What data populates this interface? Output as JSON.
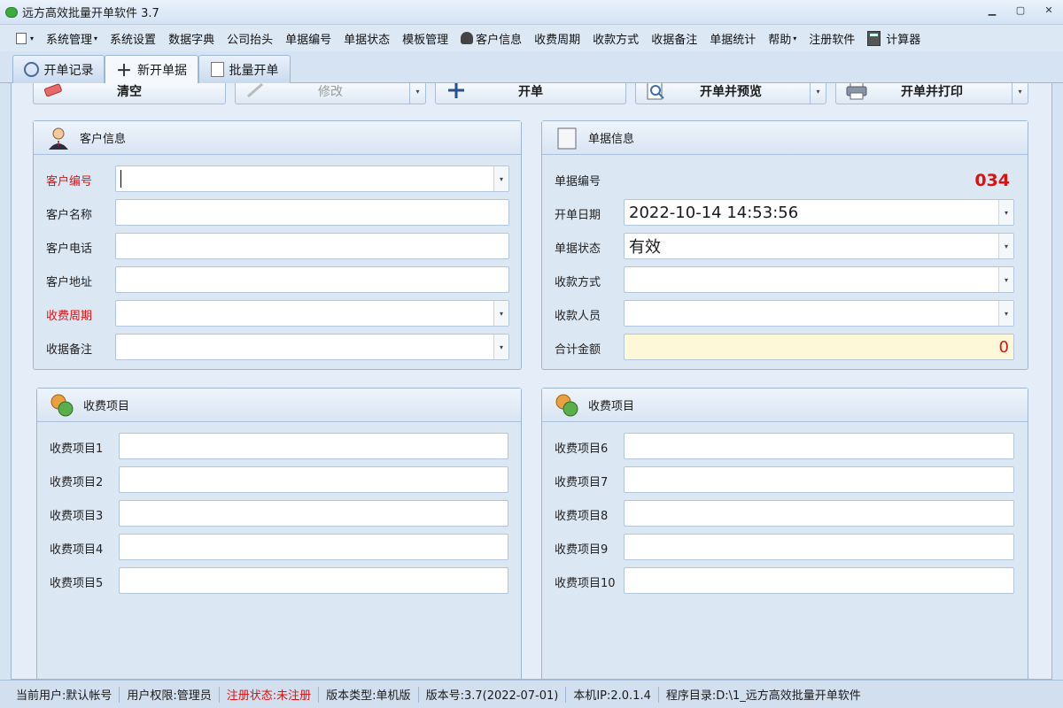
{
  "window": {
    "title": "远方高效批量开单软件 3.7"
  },
  "menu": {
    "items": [
      "系统管理",
      "系统设置",
      "数据字典",
      "公司抬头",
      "单据编号",
      "单据状态",
      "模板管理",
      "客户信息",
      "收费周期",
      "收款方式",
      "收据备注",
      "单据统计",
      "帮助",
      "注册软件",
      "计算器"
    ]
  },
  "tabs": [
    {
      "label": "开单记录",
      "icon": "clock-icon"
    },
    {
      "label": "新开单据",
      "icon": "plus-icon"
    },
    {
      "label": "批量开单",
      "icon": "batch-doc-icon"
    }
  ],
  "toolbar": {
    "clear": "清空",
    "edit": "修改",
    "create": "开单",
    "create_preview": "开单并预览",
    "create_print": "开单并打印"
  },
  "customer": {
    "title": "客户信息",
    "labels": [
      "客户编号",
      "客户名称",
      "客户电话",
      "客户地址",
      "收费周期",
      "收据备注"
    ]
  },
  "bill": {
    "title": "单据信息",
    "labels": [
      "单据编号",
      "开单日期",
      "单据状态",
      "收款方式",
      "收款人员",
      "合计金额"
    ],
    "number": "034",
    "date": "2022-10-14 14:53:56",
    "status": "有效",
    "total": "0"
  },
  "fees_left": {
    "title": "收费项目",
    "labels": [
      "收费项目1",
      "收费项目2",
      "收费项目3",
      "收费项目4",
      "收费项目5"
    ]
  },
  "fees_right": {
    "title": "收费项目",
    "labels": [
      "收费项目6",
      "收费项目7",
      "收费项目8",
      "收费项目9",
      "收费项目10"
    ]
  },
  "status": {
    "user": "当前用户:默认帐号",
    "role": "用户权限:管理员",
    "reg": "注册状态:未注册",
    "edition": "版本类型:单机版",
    "version": "版本号:3.7(2022-07-01)",
    "ip": "本机IP:2.0.1.4",
    "dir": "程序目录:D:\\1_远方高效批量开单软件"
  },
  "colors": {
    "accent": "#e01010",
    "panel": "#dce7f4",
    "border": "#9fb6d3"
  }
}
